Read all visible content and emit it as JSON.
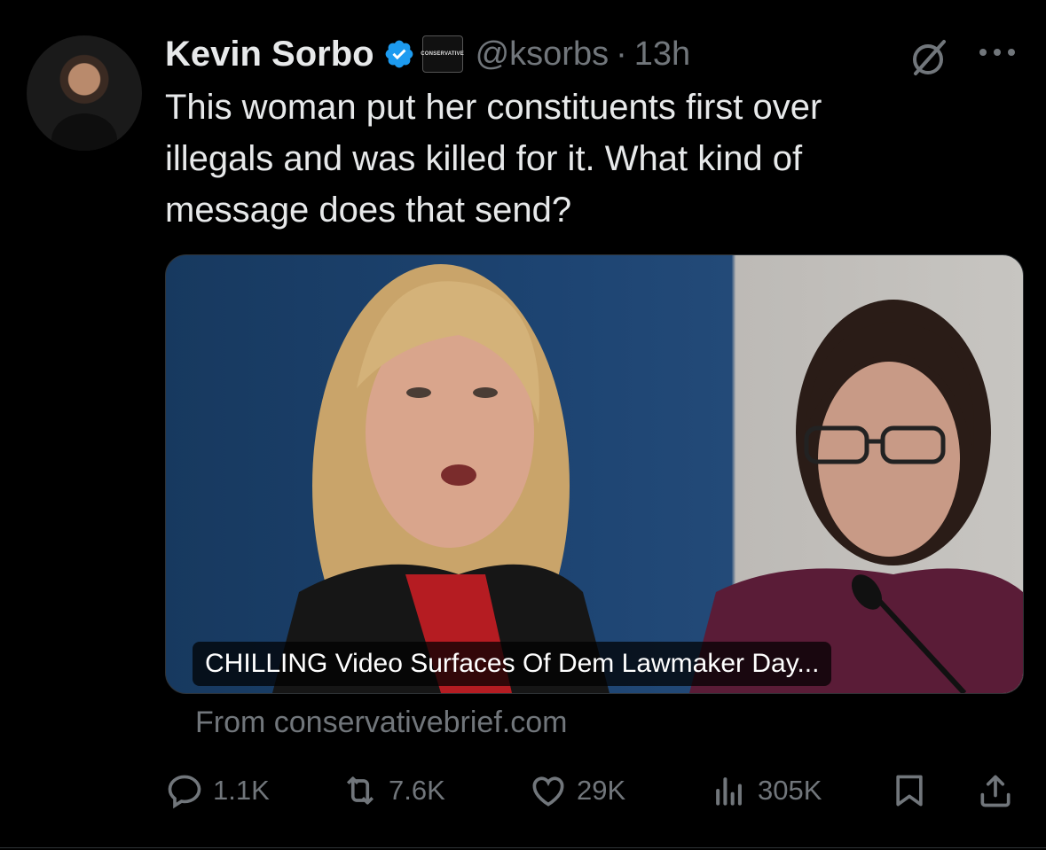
{
  "author": {
    "display_name": "Kevin Sorbo",
    "handle": "@ksorbs",
    "separator": "·",
    "timestamp": "13h",
    "affiliation_badge": "CONSERVATIVE"
  },
  "tweet": {
    "text": "This woman put her constituents first over\nillegals and was killed for it. What kind of\nmessage does that send?"
  },
  "link_card": {
    "title": "CHILLING Video Surfaces Of Dem Lawmaker Day...",
    "source": "From conservativebrief.com"
  },
  "actions": {
    "replies": "1.1K",
    "reposts": "7.6K",
    "likes": "29K",
    "views": "305K"
  },
  "icons": [
    "verified-badge-icon",
    "grok-icon",
    "more-icon",
    "reply-icon",
    "repost-icon",
    "like-icon",
    "views-icon",
    "bookmark-icon",
    "share-icon"
  ],
  "colors": {
    "background": "#000000",
    "text_primary": "#e7e9ea",
    "text_secondary": "#71767b",
    "verified": "#1d9bf0"
  }
}
